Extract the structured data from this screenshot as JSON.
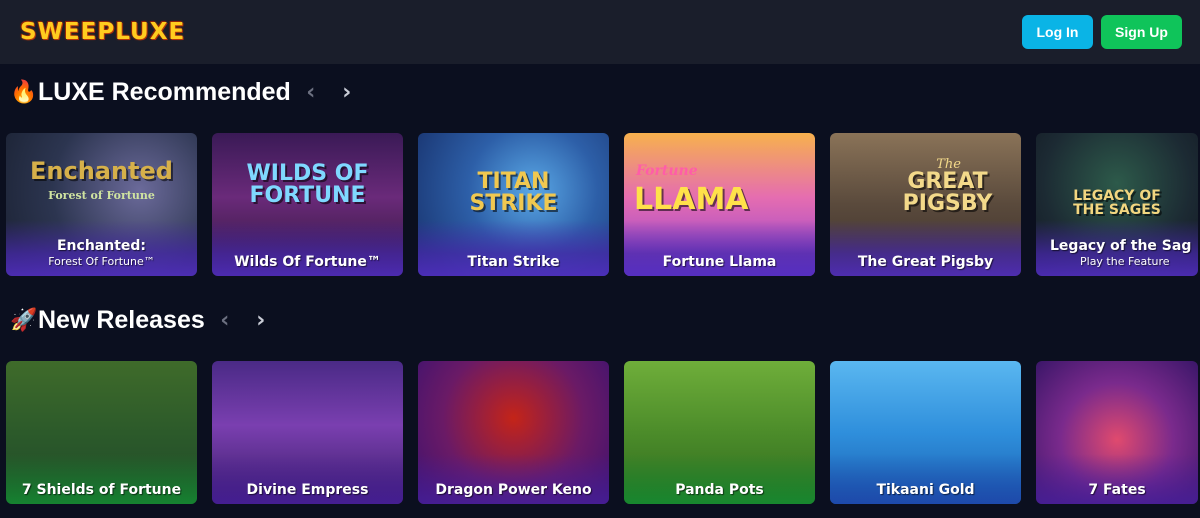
{
  "header": {
    "logo": "SWEEPLUXE",
    "login_label": "Log In",
    "signup_label": "Sign Up"
  },
  "sections": [
    {
      "emoji": "🔥",
      "title": "LUXE Recommended",
      "cards": [
        {
          "art": "Enchanted",
          "art_sub": "Forest of Fortune",
          "label_main": "Enchanted:",
          "label_sub": "Forest Of Fortune™"
        },
        {
          "art": "WILDS OF FORTUNE",
          "art_sub": "",
          "label_main": "Wilds Of Fortune™",
          "label_sub": ""
        },
        {
          "art": "TITAN STRIKE",
          "art_sub": "",
          "label_main": "Titan Strike",
          "label_sub": ""
        },
        {
          "art": "LLAMA",
          "art_sub": "Fortune",
          "label_main": "Fortune Llama",
          "label_sub": ""
        },
        {
          "art": "GREAT PIGSBY",
          "art_sub": "The",
          "label_main": "The Great Pigsby",
          "label_sub": ""
        },
        {
          "art": "LEGACY OF THE SAGES",
          "art_sub": "",
          "label_main": "Legacy of the Sag",
          "label_sub": "Play the Feature"
        }
      ]
    },
    {
      "emoji": "🚀",
      "title": "New Releases",
      "cards": [
        {
          "label_main": "7 Shields of Fortune"
        },
        {
          "label_main": "Divine Empress"
        },
        {
          "label_main": "Dragon Power Keno"
        },
        {
          "label_main": "Panda Pots"
        },
        {
          "label_main": "Tikaani Gold"
        },
        {
          "label_main": "7 Fates"
        }
      ]
    }
  ],
  "colors": {
    "background": "#0b0f1f",
    "header": "#1a1e2b",
    "login_button": "#0ab4e6",
    "signup_button": "#0fc45a",
    "logo": "#ffcc1f"
  },
  "icons": {
    "prev": "chevron-left-icon",
    "next": "chevron-right-icon"
  }
}
